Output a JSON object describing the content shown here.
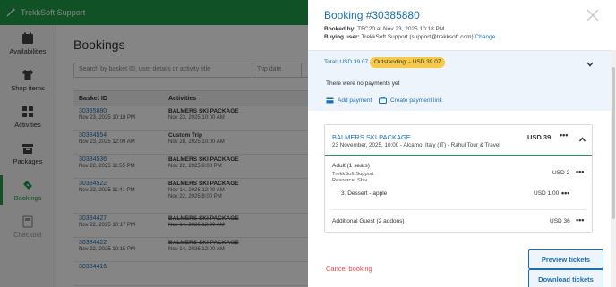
{
  "topbar": {
    "title": "TrekkSoft Support"
  },
  "sidebar": {
    "items": [
      {
        "label": "Availabilities",
        "icon": "calendar-icon"
      },
      {
        "label": "Shop items",
        "icon": "shirt-icon"
      },
      {
        "label": "Activities",
        "icon": "grid-icon"
      },
      {
        "label": "Packages",
        "icon": "box-icon"
      },
      {
        "label": "Bookings",
        "icon": "ticket-icon"
      },
      {
        "label": "Checkout",
        "icon": "checkout-icon"
      }
    ]
  },
  "main": {
    "title": "Bookings",
    "search_placeholder": "Search by basket ID, user details or activity title",
    "trip_date_placeholder": "Trip date",
    "columns": [
      "Basket ID",
      "Activities"
    ],
    "rows": [
      {
        "id": "30385880",
        "date": "Nov 23, 2025 10:18 PM",
        "activity": "BALMERS SKI PACKAGE",
        "act_date": "Nov 23, 2025 10:00 AM"
      },
      {
        "id": "30384554",
        "date": "Nov 23, 2025 12:09 AM",
        "activity": "Custom Trip",
        "act_date": "Nov 28, 2025 10:00 AM"
      },
      {
        "id": "30384536",
        "date": "Nov 22, 2025 11:55 PM",
        "activity": "BALMERS SKI PACKAGE",
        "act_date": "Nov 22, 2025 8:00 PM"
      },
      {
        "id": "30384522",
        "date": "Nov 22, 2025 11:41 PM",
        "activity": "BALMERS SKI PACKAGE",
        "act_date": "Nov 14, 2026 12:00 AM",
        "act_date2": "Nov 22, 2025 8:00 PM"
      },
      {
        "id": "30384427",
        "date": "Nov 22, 2025 10:17 PM",
        "activity": "BALMERS SKI PACKAGE",
        "act_date": "Nov 14, 2026 12:00 AM"
      },
      {
        "id": "30384422",
        "date": "Nov 22, 2025 10:15 PM",
        "activity": "BALMERS SKI PACKAGE",
        "act_date": "Nov 14, 2026 12:00 AM"
      },
      {
        "id": "30384416",
        "date": "",
        "activity": "",
        "act_date": ""
      }
    ]
  },
  "panel": {
    "title": "Booking #30385880",
    "booked_by_label": "Booked by:",
    "booked_by_value": "TFC20 at Nov 23, 2025 10:18 PM",
    "buying_user_label": "Buying user:",
    "buying_user_value": "TrekkSoft Support (support@trekksoft.com)",
    "change_link": "Change",
    "total": "Total: USD 39.07",
    "outstanding": "Outstanding: - USD 39.07",
    "no_payments": "There were no payments yet",
    "add_payment": "Add payment",
    "create_link": "Create payment link",
    "package": {
      "name": "BALMERS SKI PACKAGE",
      "description": "23 November, 2025, 10:00 - Alcamo, Italy (IT) - Rahul Tour & Travel",
      "price": "USD 39"
    },
    "lines": [
      {
        "label": "Adult (1 seats)",
        "sub1": "TrekkSoft Support",
        "sub2": "Resource: Shiv",
        "price": "USD 2"
      },
      {
        "label": "3. Dessert - apple",
        "price": "USD 1.00"
      },
      {
        "label": "Additional Guest (2 addons)",
        "price": "USD 36"
      }
    ],
    "cancel": "Cancel booking",
    "preview_tickets": "Preview tickets",
    "download_tickets": "Download tickets"
  }
}
